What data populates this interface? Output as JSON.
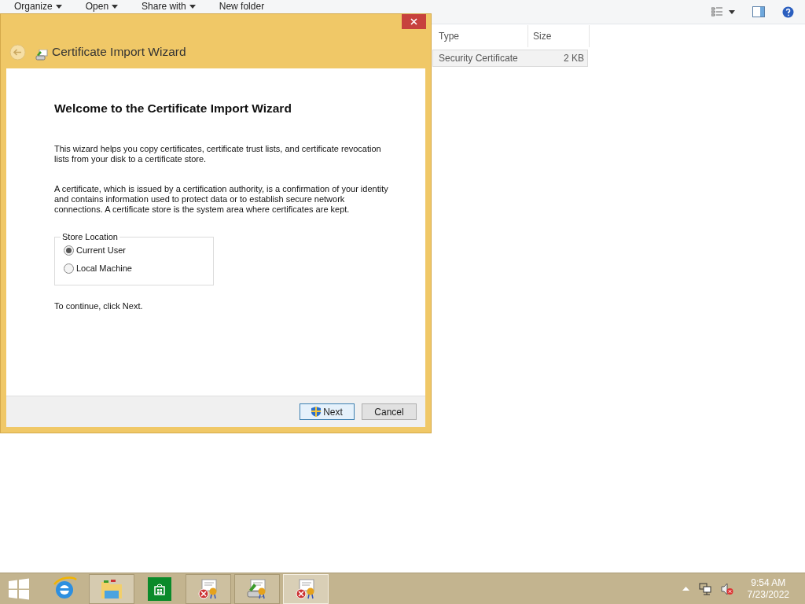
{
  "explorer": {
    "toolbar": [
      {
        "label": "Organize",
        "dropdown": true
      },
      {
        "label": "Open",
        "dropdown": true
      },
      {
        "label": "Share with",
        "dropdown": true
      },
      {
        "label": "New folder",
        "dropdown": false
      }
    ],
    "columns": [
      "Type",
      "Size"
    ],
    "rows": [
      {
        "type": "Security Certificate",
        "size": "2 KB",
        "selected": true
      }
    ]
  },
  "dialog": {
    "title": "Certificate Import Wizard",
    "heading": "Welcome to the Certificate Import Wizard",
    "paragraphs": [
      "This wizard helps you copy certificates, certificate trust lists, and certificate revocation lists from your disk to a certificate store.",
      "A certificate, which is issued by a certification authority, is a confirmation of your identity and contains information used to protect data or to establish secure network connections. A certificate store is the system area where certificates are kept."
    ],
    "store_location": {
      "label": "Store Location",
      "options": [
        {
          "label": "Current User",
          "selected": true
        },
        {
          "label": "Local Machine",
          "selected": false
        }
      ]
    },
    "instruction": "To continue, click Next.",
    "buttons": [
      {
        "label": "Next",
        "kind": "primary"
      },
      {
        "label": "Cancel",
        "kind": "default"
      }
    ]
  },
  "taskbar": {
    "time": "9:54 AM",
    "date": "7/23/2022"
  }
}
